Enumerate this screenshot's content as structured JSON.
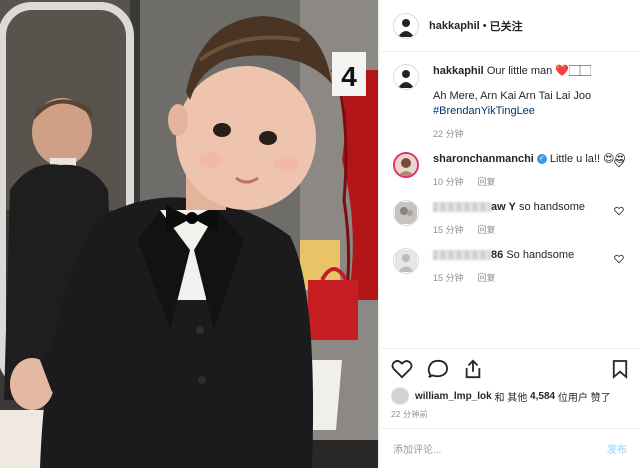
{
  "post": {
    "username": "hakkaphil",
    "follow_label": "已关注",
    "caption_text": "Our little man ❤️🏻🏻",
    "caption_line2": "Ah Mere, Arn Kai Arn Tai Lai Joo",
    "caption_tag": "#BrendanYikTingLee",
    "caption_time": "22 分钟",
    "photo_room_number": "4"
  },
  "comments": [
    {
      "user": "sharonchanmanchi",
      "text": "Little u la!! 😍😍",
      "time": "10 分钟",
      "reply": "回复"
    },
    {
      "user_suffix": "aw Y",
      "text": "so handsome",
      "time": "15 分钟",
      "reply": "回复"
    },
    {
      "user_suffix": "86",
      "text": "So handsome",
      "time": "15 分钟",
      "reply": "回复"
    }
  ],
  "likes": {
    "user": "william_lmp_lok",
    "and_others": "和 其他",
    "count": "4,584",
    "suffix": "位用户 赞了"
  },
  "post_time": "22 分钟前",
  "add_comment": {
    "placeholder": "添加评论...",
    "post_label": "发布"
  },
  "icons": [
    "heart-icon",
    "comment-icon",
    "share-icon",
    "bookmark-icon"
  ]
}
